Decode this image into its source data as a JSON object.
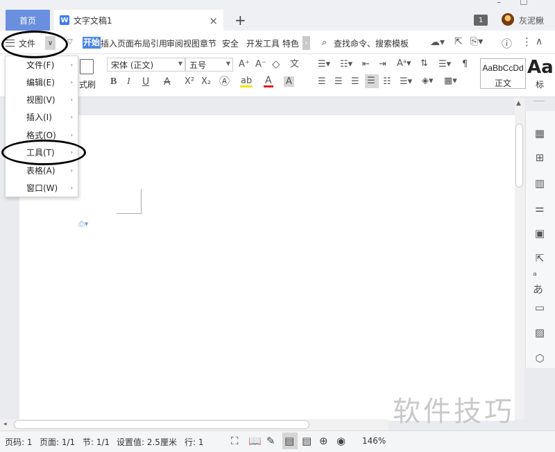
{
  "titlebar": {
    "home_tab": "首页",
    "doc_icon": "W",
    "doc_tab": "文字文稿1",
    "close": "×",
    "new_tab": "+",
    "badge": "1",
    "username": "灰泥鳅",
    "min": "–",
    "max": "☐"
  },
  "menubar": {
    "file": "文件",
    "chevron": "∨",
    "ribbon_tabs": [
      "开始",
      "插入",
      "页面布局",
      "引用",
      "审阅",
      "视图",
      "章节",
      "安全",
      "开发工具",
      "特色"
    ],
    "more_arrow": "›",
    "search": "查找命令、搜索模板"
  },
  "ribbon": {
    "format_painter": "式刷",
    "font_name": "宋体 (正文)",
    "font_size": "五号",
    "style_normal_preview": "AaBbCcDd",
    "style_normal_label": "正文",
    "style_heading_preview": "Aa",
    "style_heading_label": "标",
    "bold": "B",
    "italic": "I",
    "underline": "U",
    "strikethrough": "A",
    "superscript": "X²",
    "subscript": "X₂",
    "font_color": "A",
    "highlight": "ab",
    "char_shading": "A",
    "wen": "文",
    "grow": "A⁺",
    "shrink": "A⁻"
  },
  "context_menu": {
    "items": [
      {
        "label": "文件(F)"
      },
      {
        "label": "编辑(E)"
      },
      {
        "label": "视图(V)"
      },
      {
        "label": "插入(I)"
      },
      {
        "label": "格式(O)"
      },
      {
        "label": "工具(T)"
      },
      {
        "label": "表格(A)"
      },
      {
        "label": "窗口(W)"
      }
    ],
    "submenu_arrow": "›"
  },
  "statusbar": {
    "page_num": "页码: 1",
    "pages": "页面: 1/1",
    "section": "节: 1/1",
    "setting": "设置值: 2.5厘米",
    "row": "行: 1",
    "zoom": "146%"
  },
  "watermark": "软件技巧",
  "colors": {
    "accent": "#4a86e8",
    "home_tab": "#6a8fdf"
  }
}
